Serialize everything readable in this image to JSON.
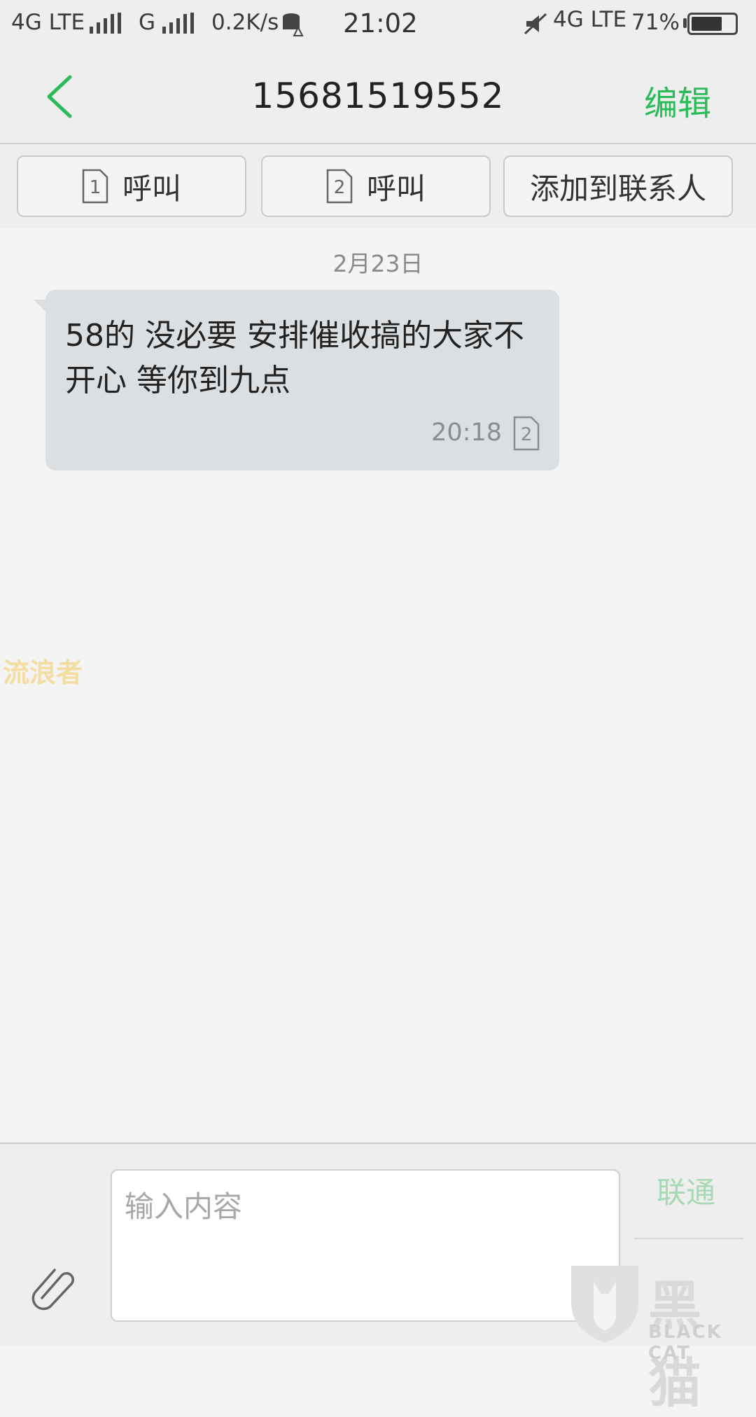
{
  "status_bar": {
    "network1": "4G LTE",
    "network2": "G",
    "speed": "0.2K/s",
    "time": "21:02",
    "network3": "4G LTE",
    "battery": "71%"
  },
  "header": {
    "title": "15681519552",
    "edit_label": "编辑"
  },
  "actions": {
    "call_sim1_label": "呼叫",
    "sim1_number": "1",
    "call_sim2_label": "呼叫",
    "sim2_number": "2",
    "add_contact_label": "添加到联系人"
  },
  "conversation": {
    "date": "2月23日",
    "messages": [
      {
        "text": "58的  没必要  安排催收搞的大家不开心  等你到九点",
        "time": "20:18",
        "sim": "2"
      }
    ]
  },
  "composer": {
    "placeholder": "输入内容",
    "carrier": "联通"
  },
  "watermark": {
    "left_text": "流浪者",
    "logo_cn": "黑猫",
    "logo_en": "BLACK CAT"
  },
  "colors": {
    "accent": "#2dbb5a",
    "bubble": "#dcdfe2",
    "background": "#f4f4f4"
  }
}
